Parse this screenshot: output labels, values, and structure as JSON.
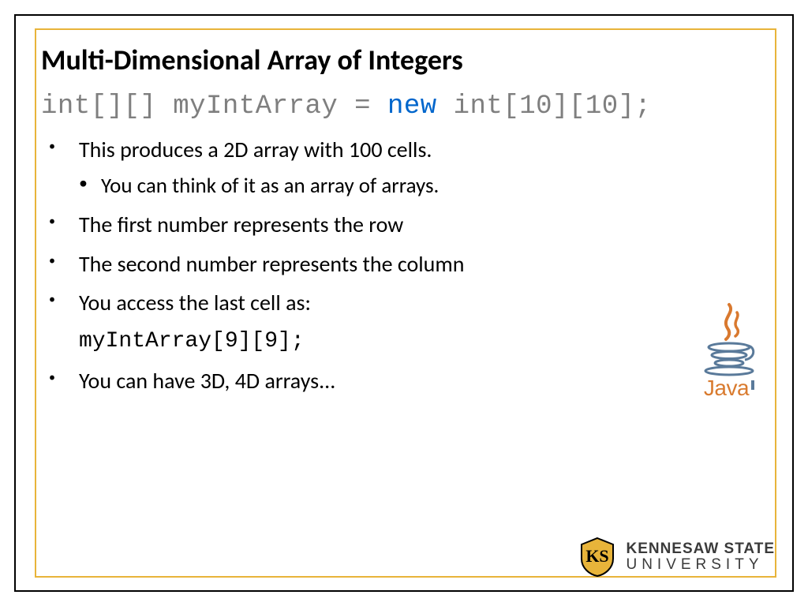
{
  "title": "Multi-Dimensional Array of Integers",
  "code_declaration": {
    "prefix": "int[][] myIntArray = ",
    "keyword": "new",
    "suffix": " int[10][10];"
  },
  "bullets": {
    "b1": "This produces a 2D array with 100 cells.",
    "b1a": "You can think of it as an array of arrays.",
    "b2": "The first number represents the row",
    "b3": "The second number represents the column",
    "b4": "You access the last cell as:",
    "b4code": "myIntArray[9][9];",
    "b5": "You can have 3D, 4D arrays..."
  },
  "logos": {
    "java_label": "Java",
    "ksu_line1": "KENNESAW STATE",
    "ksu_line2": "UNIVERSITY"
  }
}
